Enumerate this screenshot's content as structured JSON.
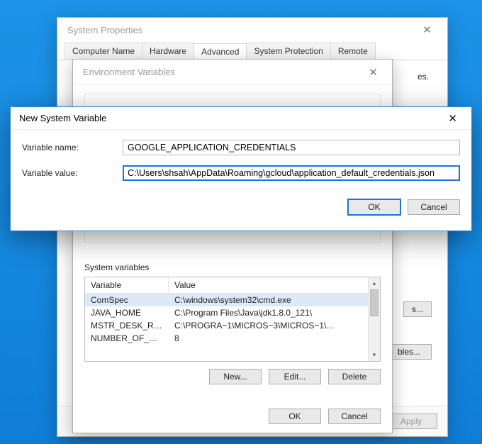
{
  "sysprop": {
    "title": "System Properties",
    "tabs": [
      "Computer Name",
      "Hardware",
      "Advanced",
      "System Protection",
      "Remote"
    ],
    "active_tab": 2,
    "hint_tail": "es.",
    "stack_a": "s...",
    "stack_b": "bles...",
    "footer": {
      "ok": "OK",
      "cancel": "Cancel",
      "apply": "Apply"
    }
  },
  "envvar": {
    "title": "Environment Variables",
    "system_label": "System variables",
    "headers": {
      "var": "Variable",
      "val": "Value"
    },
    "rows": [
      {
        "var": "ComSpec",
        "val": "C:\\windows\\system32\\cmd.exe"
      },
      {
        "var": "JAVA_HOME",
        "val": "C:\\Program Files\\Java\\jdk1.8.0_121\\"
      },
      {
        "var": "MSTR_DESK_RE...",
        "val": "C:\\PROGRA~1\\MICROS~3\\MICROS~1\\..."
      },
      {
        "var": "NUMBER_OF_PR...",
        "val": "8"
      }
    ],
    "buttons": {
      "new": "New...",
      "edit": "Edit...",
      "delete": "Delete"
    },
    "footer": {
      "ok": "OK",
      "cancel": "Cancel"
    }
  },
  "newvar": {
    "title": "New System Variable",
    "name_label": "Variable name:",
    "value_label": "Variable value:",
    "name_value": "GOOGLE_APPLICATION_CREDENTIALS",
    "value_value": "C:\\Users\\shsah\\AppData\\Roaming\\gcloud\\application_default_credentials.json",
    "footer": {
      "ok": "OK",
      "cancel": "Cancel"
    }
  }
}
